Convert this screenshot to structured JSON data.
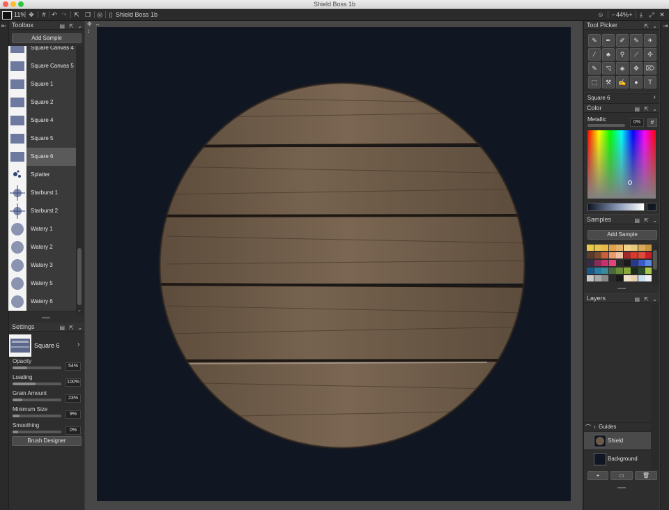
{
  "window": {
    "title": "Shield Boss 1b"
  },
  "toolbar": {
    "zoom_left": "11%",
    "doc_name": "Shield Boss 1b",
    "zoom_right": "44%"
  },
  "toolbox": {
    "title": "Toolbox",
    "add_sample": "Add Sample",
    "brushes": [
      {
        "label": "Square Canvas 4"
      },
      {
        "label": "Square Canvas 5"
      },
      {
        "label": "Square 1"
      },
      {
        "label": "Square 2"
      },
      {
        "label": "Square 4"
      },
      {
        "label": "Square 5"
      },
      {
        "label": "Square 6",
        "selected": true
      },
      {
        "label": "Splatter"
      },
      {
        "label": "Starburst 1"
      },
      {
        "label": "Starburst 2"
      },
      {
        "label": "Watery 1"
      },
      {
        "label": "Watery 2"
      },
      {
        "label": "Watery 3"
      },
      {
        "label": "Watery 5"
      },
      {
        "label": "Watery 6"
      }
    ]
  },
  "settings": {
    "title": "Settings",
    "brush_name": "Square 6",
    "sliders": [
      {
        "label": "Opacity",
        "value": "54%",
        "fraction": 0.54
      },
      {
        "label": "Loading",
        "value": "100%",
        "fraction": 1.0
      },
      {
        "label": "Grain Amount",
        "value": "23%",
        "fraction": 0.23
      },
      {
        "label": "Minimum Size",
        "value": "9%",
        "fraction": 0.09
      },
      {
        "label": "Smoothing",
        "value": "0%",
        "fraction": 0.0
      }
    ],
    "brush_designer": "Brush Designer"
  },
  "tool_picker": {
    "title": "Tool Picker",
    "current_tool": "Square 6"
  },
  "color": {
    "title": "Color",
    "metallic_label": "Metallic",
    "metallic_value": "0%",
    "hash": "#"
  },
  "samples": {
    "title": "Samples",
    "add_sample": "Add Sample",
    "swatches": [
      "#e8c94a",
      "#e9c34f",
      "#e8b84a",
      "#e0a24a",
      "#e6b36a",
      "#f0d28a",
      "#e8c87a",
      "#d8a95a",
      "#c8943f",
      "#5a3a2a",
      "#7a4a2a",
      "#c8603a",
      "#e89a6a",
      "#f0c0a0",
      "#a02a2a",
      "#d83a2a",
      "#e04a3a",
      "#c81e2a",
      "#3a2a4a",
      "#8a2a5a",
      "#c8326a",
      "#e0467a",
      "#2a2a2a",
      "#1a1a1a",
      "#2a3a8a",
      "#3a5ac8",
      "#5a8ae0",
      "#1a5a8a",
      "#2a7aa8",
      "#3a8a9a",
      "#4a6a3a",
      "#6a8a3a",
      "#8aa83a",
      "#1a2a1a",
      "#2a4a2a",
      "#a8c84a",
      "#c8c8c8",
      "#a8a8a8",
      "#8a8a8a",
      "#2a2a2a",
      "#1a1a1a",
      "#f0e0c8",
      "#e8d0b0",
      "#c8e0f0",
      "#f0f0f0"
    ]
  },
  "layers": {
    "title": "Layers",
    "guides": "Guides",
    "items": [
      {
        "label": "Shield",
        "selected": true
      },
      {
        "label": "Background",
        "selected": false
      }
    ]
  },
  "colors": {
    "canvas_bg": "#101622",
    "wood": "#6b5a48"
  }
}
